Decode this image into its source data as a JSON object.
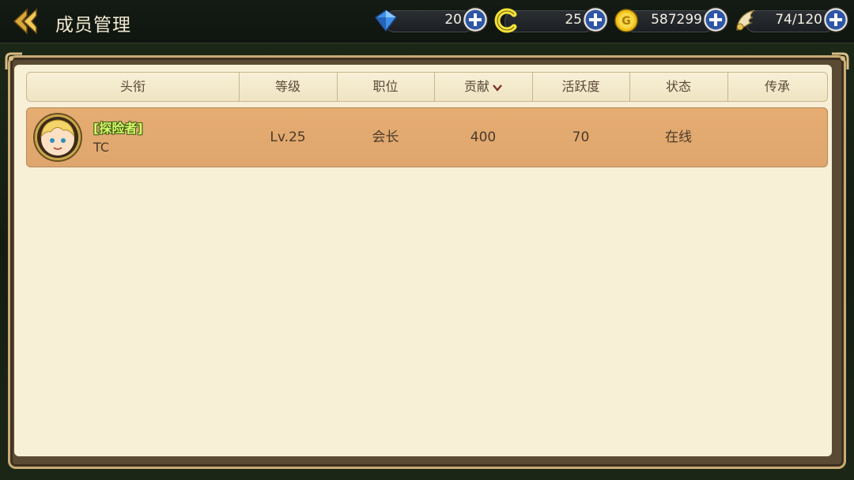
{
  "header": {
    "title": "成员管理",
    "resources": [
      {
        "name": "diamond",
        "value": "20",
        "icon": "diamond-icon"
      },
      {
        "name": "token",
        "value": "25",
        "icon": "token-icon"
      },
      {
        "name": "gold",
        "value": "587299",
        "icon": "gold-coin-icon"
      },
      {
        "name": "stamina",
        "value": "74/120",
        "icon": "wing-icon"
      }
    ]
  },
  "table": {
    "columns": [
      "头衔",
      "等级",
      "职位",
      "贡献",
      "活跃度",
      "状态",
      "传承"
    ],
    "sort_column": "贡献",
    "rows": [
      {
        "title_tag": "[探险者]",
        "name": "TC",
        "level": "Lv.25",
        "position": "会长",
        "contribution": "400",
        "activity": "70",
        "status": "在线",
        "inheritance": ""
      }
    ]
  },
  "colors": {
    "panel_bg": "#f7efd6",
    "row_highlight": "#e3a970",
    "title_tag": "#d4f96a"
  }
}
